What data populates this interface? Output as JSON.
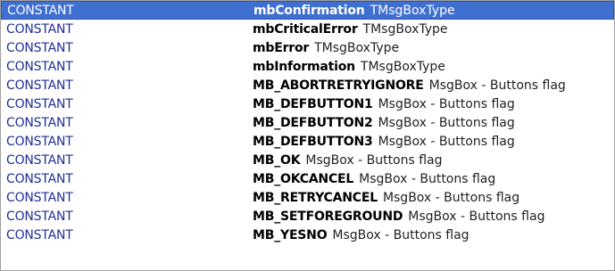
{
  "list": {
    "rows": [
      {
        "kind": "CONSTANT",
        "name": "mbConfirmation",
        "desc": "TMsgBoxType",
        "selected": true
      },
      {
        "kind": "CONSTANT",
        "name": "mbCriticalError",
        "desc": "TMsgBoxType"
      },
      {
        "kind": "CONSTANT",
        "name": "mbError",
        "desc": "TMsgBoxType"
      },
      {
        "kind": "CONSTANT",
        "name": "mbInformation",
        "desc": "TMsgBoxType"
      },
      {
        "kind": "CONSTANT",
        "name": "MB_ABORTRETRYIGNORE",
        "desc": "MsgBox - Buttons flag"
      },
      {
        "kind": "CONSTANT",
        "name": "MB_DEFBUTTON1",
        "desc": "MsgBox - Buttons flag"
      },
      {
        "kind": "CONSTANT",
        "name": "MB_DEFBUTTON2",
        "desc": "MsgBox - Buttons flag"
      },
      {
        "kind": "CONSTANT",
        "name": "MB_DEFBUTTON3",
        "desc": "MsgBox - Buttons flag"
      },
      {
        "kind": "CONSTANT",
        "name": "MB_OK",
        "desc": "MsgBox - Buttons flag"
      },
      {
        "kind": "CONSTANT",
        "name": "MB_OKCANCEL",
        "desc": "MsgBox - Buttons flag"
      },
      {
        "kind": "CONSTANT",
        "name": "MB_RETRYCANCEL",
        "desc": "MsgBox - Buttons flag"
      },
      {
        "kind": "CONSTANT",
        "name": "MB_SETFOREGROUND",
        "desc": "MsgBox - Buttons flag"
      },
      {
        "kind": "CONSTANT",
        "name": "MB_YESNO",
        "desc": "MsgBox - Buttons flag"
      }
    ]
  },
  "colors": {
    "selection_bg": "#3f6fd0",
    "kind_text": "#1f2f9a"
  }
}
